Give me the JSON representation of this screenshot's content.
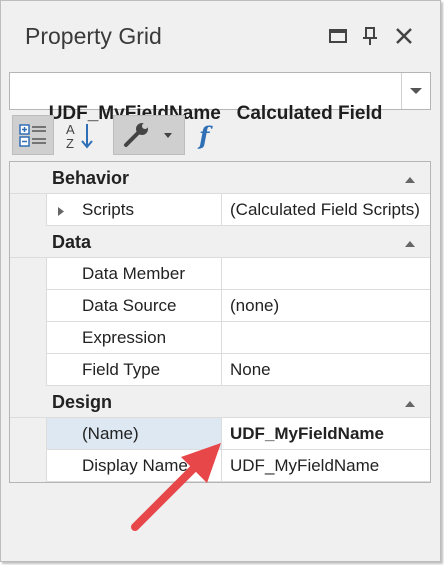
{
  "panel": {
    "title": "Property Grid",
    "maximize_icon": "maximize-icon",
    "pin_icon": "pin-icon",
    "close_icon": "close-icon"
  },
  "object_selector": {
    "name": "UDF_MyFieldName",
    "type": "Calculated Field",
    "dropdown_icon": "chevron-down-icon"
  },
  "toolbar": {
    "buttons": [
      {
        "icon": "categorized-icon",
        "active": true
      },
      {
        "icon": "sort-alphabetical-icon",
        "active": false
      },
      {
        "icon": "wrench-icon",
        "active": true,
        "has_dropdown": true
      },
      {
        "icon": "function-icon",
        "active": false
      }
    ]
  },
  "grid": {
    "categories": [
      {
        "label": "Behavior",
        "rows": [
          {
            "name": "Scripts",
            "value": "(Calculated Field Scripts)",
            "expandable": true
          }
        ]
      },
      {
        "label": "Data",
        "rows": [
          {
            "name": "Data Member",
            "value": ""
          },
          {
            "name": "Data Source",
            "value": "(none)"
          },
          {
            "name": "Expression",
            "value": ""
          },
          {
            "name": "Field Type",
            "value": "None"
          }
        ]
      },
      {
        "label": "Design",
        "rows": [
          {
            "name": "(Name)",
            "value": "UDF_MyFieldName",
            "selected": true
          },
          {
            "name": "Display Name",
            "value": "UDF_MyFieldName"
          }
        ]
      }
    ]
  },
  "annotation": {
    "arrow_color": "#e8474a"
  }
}
